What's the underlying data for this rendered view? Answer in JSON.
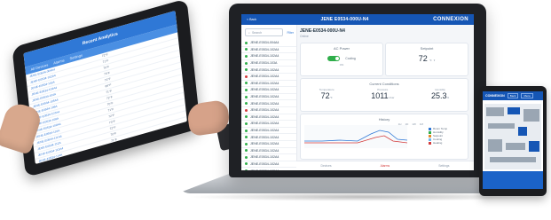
{
  "tablet": {
    "header_title": "Recent Analytics",
    "tabs": [
      "All Devices",
      "Alarms",
      "Settings"
    ],
    "rows": [
      {
        "name": "JENE-E0534-004A4",
        "value": "72°F"
      },
      {
        "name": "JENE-E0534-102A4",
        "value": "71°F"
      },
      {
        "name": "JENE-E0534-102A",
        "value": "70°F"
      },
      {
        "name": "JENE-E0534-103A4",
        "value": "73°F"
      },
      {
        "name": "JENE-E0534-104A",
        "value": "72°F"
      },
      {
        "name": "JENE-E0534-105A4",
        "value": "69°F"
      },
      {
        "name": "JENE-E0534-106A",
        "value": "71°F"
      },
      {
        "name": "JENE-E0534-107A4",
        "value": "72°F"
      },
      {
        "name": "JENE-E0534-108A",
        "value": "70°F"
      },
      {
        "name": "JENE-E0534-109A4",
        "value": "71°F"
      },
      {
        "name": "JENE-E0534-110A",
        "value": "72°F"
      },
      {
        "name": "JENE-E0534-111A4",
        "value": "73°F"
      },
      {
        "name": "JENE-E0534-112A",
        "value": "72°F"
      },
      {
        "name": "JENE-E0534-113A4",
        "value": "70°F"
      },
      {
        "name": "JENE-E0534-114A",
        "value": "71°F"
      },
      {
        "name": "JENE-E0534-115A4",
        "value": "72°F"
      },
      {
        "name": "JENE-E0534-116A",
        "value": "71°F"
      },
      {
        "name": "JENE-E0534-117A4",
        "value": "70°F"
      }
    ]
  },
  "laptop": {
    "back_label": "< Back",
    "window_title": "JENE E0534-000U-N4",
    "brand": "CONNEXION",
    "search_placeholder": "Search",
    "filter_label": "Filter",
    "devices": [
      {
        "name": "JENE-E0534-004A4",
        "status": "green"
      },
      {
        "name": "JENE-E0534-102A4",
        "status": "green"
      },
      {
        "name": "JENE-E0534-102A4",
        "status": "green"
      },
      {
        "name": "JENE-E0534-103A",
        "status": "green"
      },
      {
        "name": "JENE-E0534-102A4",
        "status": "green"
      },
      {
        "name": "JENE-E0534-102A4",
        "status": "red"
      },
      {
        "name": "JENE-E0534-102A4",
        "status": "green"
      },
      {
        "name": "JENE-E0534-102A4",
        "status": "green"
      },
      {
        "name": "JENE-E0534-102A4",
        "status": "green"
      },
      {
        "name": "JENE-E0534-102A4",
        "status": "green"
      },
      {
        "name": "JENE-E0534-102A4",
        "status": "red"
      },
      {
        "name": "JENE-E0534-102A4",
        "status": "green"
      },
      {
        "name": "JENE-E0534-102A4",
        "status": "green"
      },
      {
        "name": "JENE-E0534-102A4",
        "status": "green"
      },
      {
        "name": "JENE-E0534-102A4",
        "status": "green"
      },
      {
        "name": "JENE-E0534-102A4",
        "status": "green"
      },
      {
        "name": "JENE-E0534-102A4",
        "status": "green"
      },
      {
        "name": "JENE-E0534-102A4",
        "status": "green"
      },
      {
        "name": "JENE-E0534-102A4",
        "status": "green"
      },
      {
        "name": "JENE-E0534-102A4",
        "status": "green"
      }
    ],
    "device_name": "JENE-E0534-000U-N4",
    "device_status": "Online",
    "ac_power": {
      "title": "AC Power",
      "toggle": "ON",
      "label": "Cooling"
    },
    "setpoint": {
      "title": "Setpoint",
      "value": "72",
      "unit": "°F"
    },
    "conditions": {
      "title": "Current Conditions",
      "items": [
        {
          "label": "Temperature",
          "value": "72",
          "unit": "°F"
        },
        {
          "label": "Pressure",
          "value": "1011",
          "unit": "mbar"
        },
        {
          "label": "Humidity",
          "value": "25.3",
          "unit": "%"
        }
      ]
    },
    "history": {
      "title": "History",
      "range_tabs": [
        "1H",
        "1D",
        "1W",
        "1M"
      ],
      "legend": [
        "Room Temp",
        "Humidity",
        "Setpoint",
        "Cooling",
        "Heating"
      ],
      "legend_colors": [
        "#2f78d6",
        "#2fae4a",
        "#e08b2a",
        "#6fb6f0",
        "#d33c3c"
      ]
    },
    "bottom_nav": [
      "Devices",
      "Alarms",
      "Settings"
    ]
  },
  "phone": {
    "brand": "CONNEXION",
    "buttons": [
      "Back",
      "Menu"
    ]
  }
}
